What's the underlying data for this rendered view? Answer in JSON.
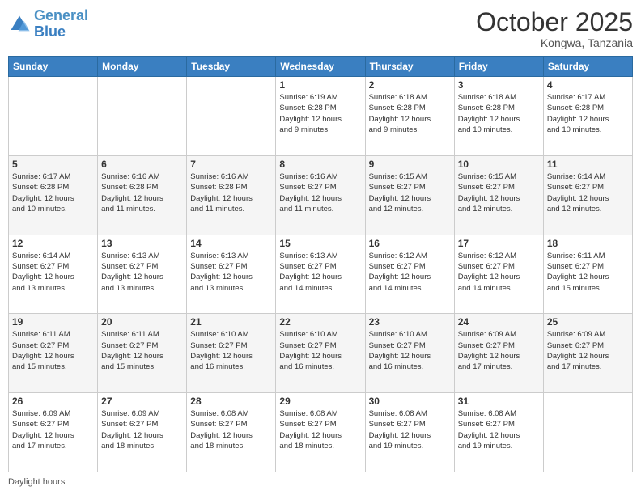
{
  "header": {
    "logo_line1": "General",
    "logo_line2": "Blue",
    "month": "October 2025",
    "location": "Kongwa, Tanzania"
  },
  "weekdays": [
    "Sunday",
    "Monday",
    "Tuesday",
    "Wednesday",
    "Thursday",
    "Friday",
    "Saturday"
  ],
  "footer": {
    "daylight_label": "Daylight hours"
  },
  "weeks": [
    [
      {
        "day": "",
        "info": ""
      },
      {
        "day": "",
        "info": ""
      },
      {
        "day": "",
        "info": ""
      },
      {
        "day": "1",
        "info": "Sunrise: 6:19 AM\nSunset: 6:28 PM\nDaylight: 12 hours\nand 9 minutes."
      },
      {
        "day": "2",
        "info": "Sunrise: 6:18 AM\nSunset: 6:28 PM\nDaylight: 12 hours\nand 9 minutes."
      },
      {
        "day": "3",
        "info": "Sunrise: 6:18 AM\nSunset: 6:28 PM\nDaylight: 12 hours\nand 10 minutes."
      },
      {
        "day": "4",
        "info": "Sunrise: 6:17 AM\nSunset: 6:28 PM\nDaylight: 12 hours\nand 10 minutes."
      }
    ],
    [
      {
        "day": "5",
        "info": "Sunrise: 6:17 AM\nSunset: 6:28 PM\nDaylight: 12 hours\nand 10 minutes."
      },
      {
        "day": "6",
        "info": "Sunrise: 6:16 AM\nSunset: 6:28 PM\nDaylight: 12 hours\nand 11 minutes."
      },
      {
        "day": "7",
        "info": "Sunrise: 6:16 AM\nSunset: 6:28 PM\nDaylight: 12 hours\nand 11 minutes."
      },
      {
        "day": "8",
        "info": "Sunrise: 6:16 AM\nSunset: 6:27 PM\nDaylight: 12 hours\nand 11 minutes."
      },
      {
        "day": "9",
        "info": "Sunrise: 6:15 AM\nSunset: 6:27 PM\nDaylight: 12 hours\nand 12 minutes."
      },
      {
        "day": "10",
        "info": "Sunrise: 6:15 AM\nSunset: 6:27 PM\nDaylight: 12 hours\nand 12 minutes."
      },
      {
        "day": "11",
        "info": "Sunrise: 6:14 AM\nSunset: 6:27 PM\nDaylight: 12 hours\nand 12 minutes."
      }
    ],
    [
      {
        "day": "12",
        "info": "Sunrise: 6:14 AM\nSunset: 6:27 PM\nDaylight: 12 hours\nand 13 minutes."
      },
      {
        "day": "13",
        "info": "Sunrise: 6:13 AM\nSunset: 6:27 PM\nDaylight: 12 hours\nand 13 minutes."
      },
      {
        "day": "14",
        "info": "Sunrise: 6:13 AM\nSunset: 6:27 PM\nDaylight: 12 hours\nand 13 minutes."
      },
      {
        "day": "15",
        "info": "Sunrise: 6:13 AM\nSunset: 6:27 PM\nDaylight: 12 hours\nand 14 minutes."
      },
      {
        "day": "16",
        "info": "Sunrise: 6:12 AM\nSunset: 6:27 PM\nDaylight: 12 hours\nand 14 minutes."
      },
      {
        "day": "17",
        "info": "Sunrise: 6:12 AM\nSunset: 6:27 PM\nDaylight: 12 hours\nand 14 minutes."
      },
      {
        "day": "18",
        "info": "Sunrise: 6:11 AM\nSunset: 6:27 PM\nDaylight: 12 hours\nand 15 minutes."
      }
    ],
    [
      {
        "day": "19",
        "info": "Sunrise: 6:11 AM\nSunset: 6:27 PM\nDaylight: 12 hours\nand 15 minutes."
      },
      {
        "day": "20",
        "info": "Sunrise: 6:11 AM\nSunset: 6:27 PM\nDaylight: 12 hours\nand 15 minutes."
      },
      {
        "day": "21",
        "info": "Sunrise: 6:10 AM\nSunset: 6:27 PM\nDaylight: 12 hours\nand 16 minutes."
      },
      {
        "day": "22",
        "info": "Sunrise: 6:10 AM\nSunset: 6:27 PM\nDaylight: 12 hours\nand 16 minutes."
      },
      {
        "day": "23",
        "info": "Sunrise: 6:10 AM\nSunset: 6:27 PM\nDaylight: 12 hours\nand 16 minutes."
      },
      {
        "day": "24",
        "info": "Sunrise: 6:09 AM\nSunset: 6:27 PM\nDaylight: 12 hours\nand 17 minutes."
      },
      {
        "day": "25",
        "info": "Sunrise: 6:09 AM\nSunset: 6:27 PM\nDaylight: 12 hours\nand 17 minutes."
      }
    ],
    [
      {
        "day": "26",
        "info": "Sunrise: 6:09 AM\nSunset: 6:27 PM\nDaylight: 12 hours\nand 17 minutes."
      },
      {
        "day": "27",
        "info": "Sunrise: 6:09 AM\nSunset: 6:27 PM\nDaylight: 12 hours\nand 18 minutes."
      },
      {
        "day": "28",
        "info": "Sunrise: 6:08 AM\nSunset: 6:27 PM\nDaylight: 12 hours\nand 18 minutes."
      },
      {
        "day": "29",
        "info": "Sunrise: 6:08 AM\nSunset: 6:27 PM\nDaylight: 12 hours\nand 18 minutes."
      },
      {
        "day": "30",
        "info": "Sunrise: 6:08 AM\nSunset: 6:27 PM\nDaylight: 12 hours\nand 19 minutes."
      },
      {
        "day": "31",
        "info": "Sunrise: 6:08 AM\nSunset: 6:27 PM\nDaylight: 12 hours\nand 19 minutes."
      },
      {
        "day": "",
        "info": ""
      }
    ]
  ]
}
